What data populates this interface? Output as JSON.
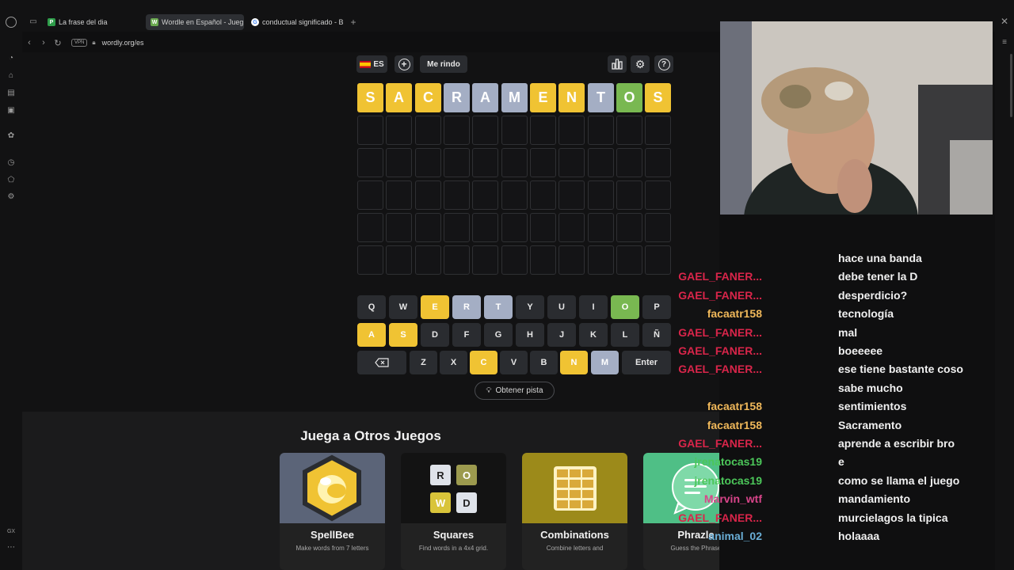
{
  "browser": {
    "tabs": [
      {
        "label": "La frase del dia",
        "color": "#2e9d4a",
        "glyph": "P"
      },
      {
        "label": "Wordle en Español - Jueg",
        "color": "#6aa84f",
        "glyph": "W"
      },
      {
        "label": "conductual significado - B",
        "color": "#4285f4",
        "glyph": "G"
      }
    ],
    "new_tab": "+",
    "vpn_label": "VPN",
    "url": "wordly.org/es",
    "sidebar_bottom_label": "GX"
  },
  "game": {
    "language_label": "ES",
    "give_up_label": "Me rindo",
    "guess": [
      "S",
      "A",
      "C",
      "R",
      "A",
      "M",
      "E",
      "N",
      "T",
      "O",
      "S"
    ],
    "guess_status": [
      "present",
      "present",
      "present",
      "absent",
      "absent",
      "absent",
      "present",
      "present",
      "absent",
      "correct",
      "present"
    ],
    "empty_rows": 5,
    "keyboard": {
      "row1": [
        {
          "k": "Q",
          "s": "none"
        },
        {
          "k": "W",
          "s": "none"
        },
        {
          "k": "E",
          "s": "present"
        },
        {
          "k": "R",
          "s": "absent"
        },
        {
          "k": "T",
          "s": "absent"
        },
        {
          "k": "Y",
          "s": "none"
        },
        {
          "k": "U",
          "s": "none"
        },
        {
          "k": "I",
          "s": "none"
        },
        {
          "k": "O",
          "s": "correct"
        },
        {
          "k": "P",
          "s": "none"
        }
      ],
      "row2": [
        {
          "k": "A",
          "s": "present"
        },
        {
          "k": "S",
          "s": "present"
        },
        {
          "k": "D",
          "s": "none"
        },
        {
          "k": "F",
          "s": "none"
        },
        {
          "k": "G",
          "s": "none"
        },
        {
          "k": "H",
          "s": "none"
        },
        {
          "k": "J",
          "s": "none"
        },
        {
          "k": "K",
          "s": "none"
        },
        {
          "k": "L",
          "s": "none"
        },
        {
          "k": "Ñ",
          "s": "none"
        }
      ],
      "row3": [
        {
          "k": "Z",
          "s": "none"
        },
        {
          "k": "X",
          "s": "none"
        },
        {
          "k": "C",
          "s": "present"
        },
        {
          "k": "V",
          "s": "none"
        },
        {
          "k": "B",
          "s": "none"
        },
        {
          "k": "N",
          "s": "present"
        },
        {
          "k": "M",
          "s": "absent"
        }
      ],
      "enter_label": "Enter"
    },
    "hint_label": "Obtener pista",
    "colors": {
      "present": "#f0c333",
      "correct": "#79b851",
      "absent": "#a4aec4",
      "none": "#2a2c30"
    }
  },
  "other_games": {
    "title": "Juega a Otros Juegos",
    "cards": [
      {
        "name": "SpellBee",
        "desc": "Make words from 7 letters"
      },
      {
        "name": "Squares",
        "desc": "Find words in a 4x4 grid."
      },
      {
        "name": "Combinations",
        "desc": "Combine letters and"
      },
      {
        "name": "Phrazle",
        "desc": "Guess the Phrase"
      }
    ],
    "squares_letters": [
      "R",
      "O",
      "W",
      "D"
    ]
  },
  "chat": [
    {
      "user": "",
      "msg": "hace una banda",
      "color": "#d9254a"
    },
    {
      "user": "GAEL_FANER...",
      "msg": "debe tener la D",
      "color": "#d9254a"
    },
    {
      "user": "GAEL_FANER...",
      "msg": "desperdicio?",
      "color": "#d9254a"
    },
    {
      "user": "facaatr158",
      "msg": "tecnología",
      "color": "#f0b85a"
    },
    {
      "user": "GAEL_FANER...",
      "msg": "mal",
      "color": "#d9254a"
    },
    {
      "user": "GAEL_FANER...",
      "msg": "boeeeee",
      "color": "#d9254a"
    },
    {
      "user": "GAEL_FANER...",
      "msg": "ese tiene bastante coso",
      "color": "#d9254a"
    },
    {
      "user": "",
      "msg": "sabe mucho",
      "color": "#d9254a"
    },
    {
      "user": "facaatr158",
      "msg": "sentimientos",
      "color": "#f0b85a"
    },
    {
      "user": "facaatr158",
      "msg": "Sacramento",
      "color": "#f0b85a"
    },
    {
      "user": "GAEL_FANER...",
      "msg": "aprende a escribir bro",
      "color": "#d9254a"
    },
    {
      "user": "jrenatocas19",
      "msg": "e",
      "color": "#4cc75a"
    },
    {
      "user": "jrenatocas19",
      "msg": "como se llama el juego",
      "color": "#4cc75a"
    },
    {
      "user": "Marvin_wtf",
      "msg": "mandamiento",
      "color": "#d9458a"
    },
    {
      "user": "GAEL_FANER...",
      "msg": "murcielagos la tipica",
      "color": "#d9254a"
    },
    {
      "user": "animal_02",
      "msg": "holaaaa",
      "color": "#6aaed6"
    }
  ]
}
